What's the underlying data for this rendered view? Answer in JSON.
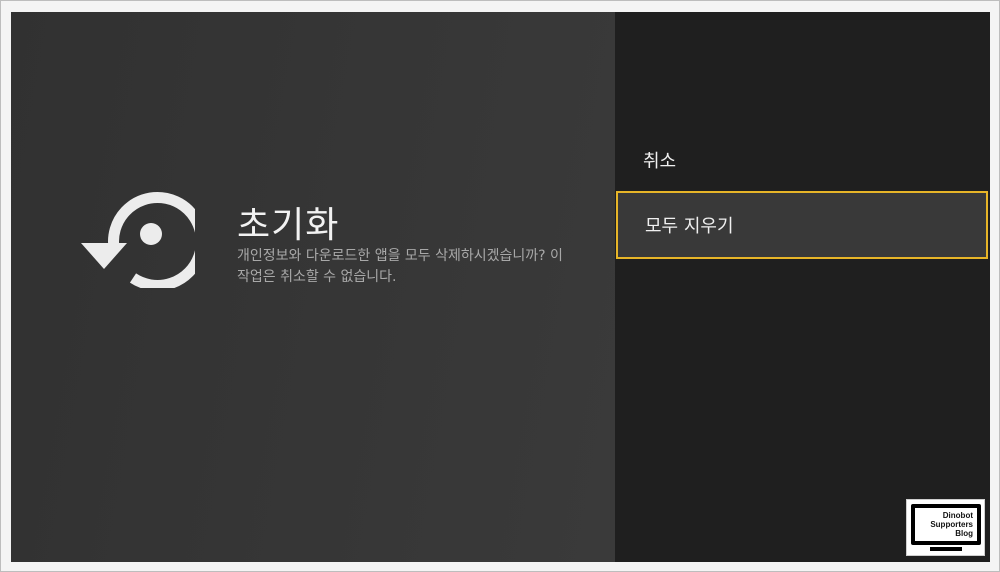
{
  "dialog": {
    "title": "초기화",
    "description_line1": "개인정보와 다운로드한 앱을 모두 삭제하시겠습니까? 이",
    "description_line2": "작업은 취소할 수 없습니다.",
    "icon": "reset-history-icon"
  },
  "options": [
    {
      "label": "취소",
      "focused": false
    },
    {
      "label": "모두 지우기",
      "focused": true
    }
  ],
  "watermark": {
    "line1": "Dinobot",
    "line2": "Supporters",
    "line3": "Blog"
  },
  "colors": {
    "focus_border": "#e7b528",
    "left_pane": "#363636",
    "right_pane": "#1f1f1f",
    "focused_option_bg": "#393939"
  }
}
